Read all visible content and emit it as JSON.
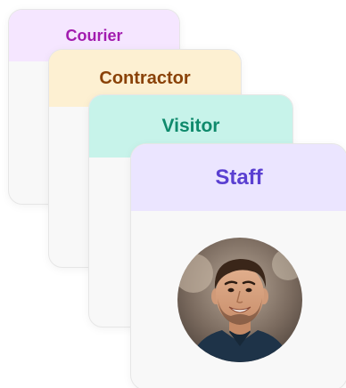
{
  "cards": [
    {
      "label": "Courier",
      "header_bg": "#f5e6ff",
      "text_color": "#a21caf"
    },
    {
      "label": "Contractor",
      "header_bg": "#fdf0d2",
      "text_color": "#8a4208"
    },
    {
      "label": "Visitor",
      "header_bg": "#c7f3ea",
      "text_color": "#0f8a6c"
    },
    {
      "label": "Staff",
      "header_bg": "#ebe5ff",
      "text_color": "#5a3fd1"
    }
  ],
  "staff_card": {
    "avatar_icon": "person-photo"
  },
  "colors": {
    "card_body": "#f8f8f8",
    "card_border": "#e6e6e6"
  }
}
